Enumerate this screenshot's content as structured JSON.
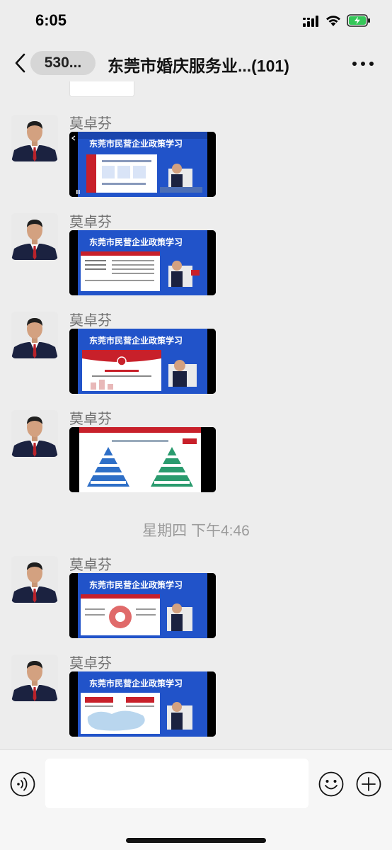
{
  "status_bar": {
    "time": "6:05"
  },
  "nav": {
    "unread_label": "530...",
    "title": "东莞市婚庆服务业...",
    "member_count": "(101)"
  },
  "messages": [
    {
      "sender": "莫卓芬",
      "video_banner": "东莞市民营企业政策学习"
    },
    {
      "sender": "莫卓芬",
      "video_banner": "东莞市民营企业政策学习"
    },
    {
      "sender": "莫卓芬",
      "video_banner": "东莞市民营企业政策学习"
    },
    {
      "sender": "莫卓芬",
      "video_banner": ""
    },
    {
      "sender": "莫卓芬",
      "video_banner": "东莞市民营企业政策学习"
    },
    {
      "sender": "莫卓芬",
      "video_banner": "东莞市民营企业政策学习"
    }
  ],
  "timestamp": "星期四 下午4:46",
  "icons": {
    "back": "back-icon",
    "more": "more-icon",
    "voice": "voice-icon",
    "emoji": "emoji-icon",
    "plus": "plus-icon"
  },
  "colors": {
    "background": "#ededed",
    "banner_blue": "#1c4fc4",
    "accent_red": "#c8202a"
  }
}
